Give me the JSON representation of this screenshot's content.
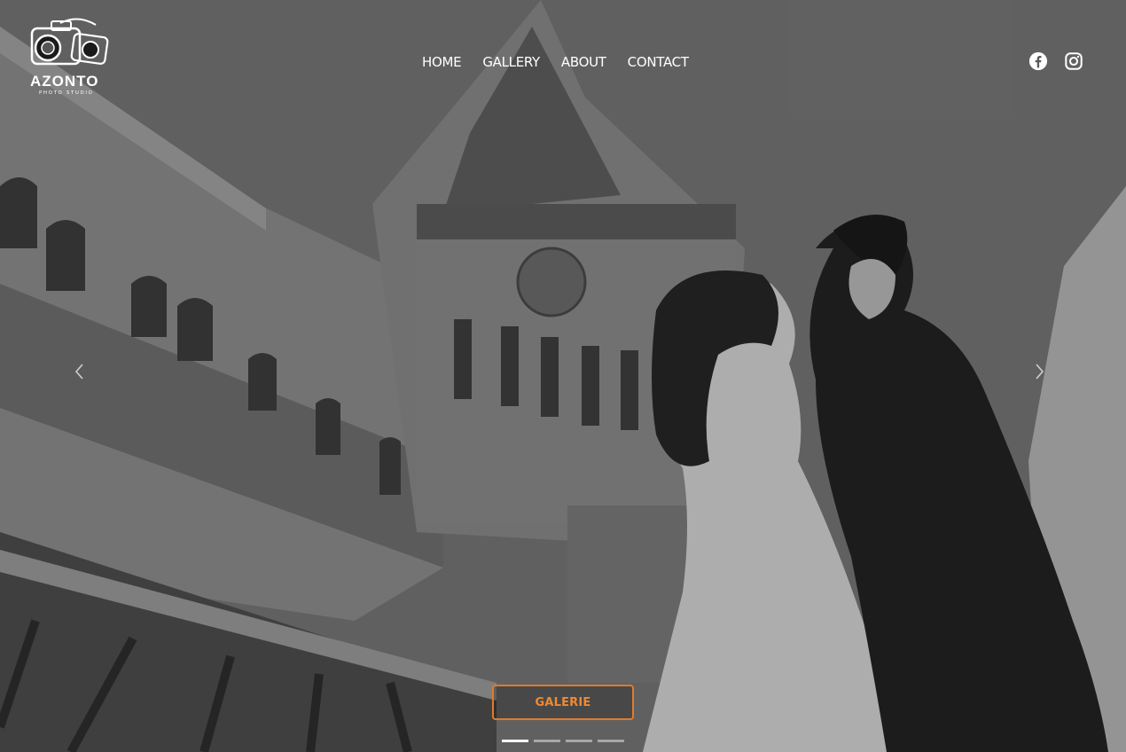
{
  "brand": {
    "name": "AZONTO",
    "tagline": "PHOTO STUDIO"
  },
  "nav": {
    "items": [
      {
        "label": "HOME"
      },
      {
        "label": "GALLERY"
      },
      {
        "label": "ABOUT"
      },
      {
        "label": "CONTACT"
      }
    ]
  },
  "social": {
    "icons": [
      "facebook-icon",
      "instagram-icon"
    ]
  },
  "carousel": {
    "cta_label": "GALERIE",
    "slide_count": 4,
    "active_slide": 1,
    "prev_icon": "chevron-left-icon",
    "next_icon": "chevron-right-icon"
  },
  "colors": {
    "accent": "#e07b2b",
    "text": "#ffffff"
  }
}
